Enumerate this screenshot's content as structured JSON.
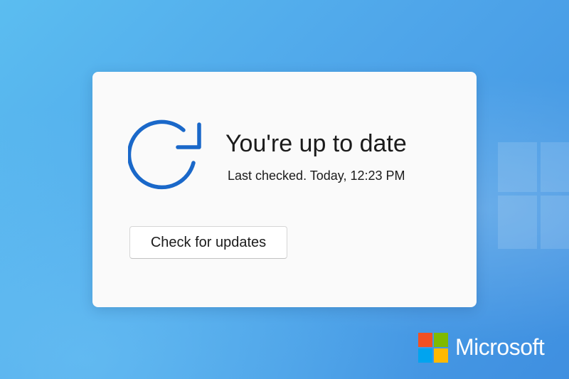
{
  "status": {
    "title": "You're up to date",
    "last_checked": "Last checked. Today, 12:23 PM",
    "icon": "sync-icon"
  },
  "actions": {
    "check_label": "Check for updates"
  },
  "brand": {
    "name": "Microsoft",
    "logo_colors": {
      "red": "#f25022",
      "green": "#7fba00",
      "blue": "#00a4ef",
      "yellow": "#ffb900"
    }
  },
  "colors": {
    "accent": "#1a68c9",
    "background": "#4fa6ea",
    "card": "#fafafa"
  }
}
